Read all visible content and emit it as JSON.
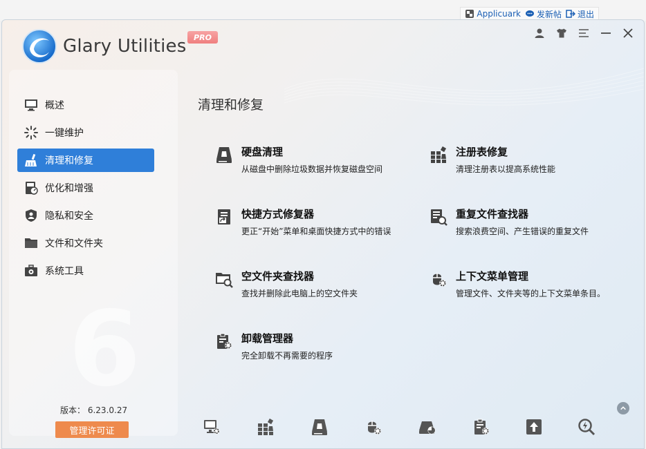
{
  "host": {
    "user": "Applicuark",
    "post_label": "发新帖",
    "logout_label": "退出"
  },
  "app": {
    "name": "Glary Utilities",
    "badge": "PRO",
    "accent_color": "#2f7fd9",
    "license_color": "#ee8a4d"
  },
  "window_controls": [
    "user-icon",
    "shirt-icon",
    "menu-icon",
    "minimize-icon",
    "close-icon"
  ],
  "sidebar": {
    "items": [
      {
        "label": "概述",
        "icon": "monitor-icon",
        "active": false
      },
      {
        "label": "一键维护",
        "icon": "sparkle-icon",
        "active": false
      },
      {
        "label": "清理和修复",
        "icon": "broom-icon",
        "active": true
      },
      {
        "label": "优化和增强",
        "icon": "speedometer-icon",
        "active": false
      },
      {
        "label": "隐私和安全",
        "icon": "shield-icon",
        "active": false
      },
      {
        "label": "文件和文件夹",
        "icon": "folder-icon",
        "active": false
      },
      {
        "label": "系统工具",
        "icon": "toolbox-icon",
        "active": false
      }
    ],
    "watermark": "6",
    "version_label": "版本：",
    "version": "6.23.0.27",
    "license_button": "管理许可证"
  },
  "main": {
    "title": "清理和修复",
    "tools": [
      {
        "title": "硬盘清理",
        "desc": "从磁盘中删除垃圾数据并恢复磁盘空间",
        "icon": "disk-cleaner-icon"
      },
      {
        "title": "注册表修复",
        "desc": "清理注册表以提高系统性能",
        "icon": "registry-icon"
      },
      {
        "title": "快捷方式修复器",
        "desc": "更正“开始”菜单和桌面快捷方式中的错误",
        "icon": "shortcut-icon"
      },
      {
        "title": "重复文件查找器",
        "desc": "搜索浪费空间、产生错误的重复文件",
        "icon": "duplicate-file-icon"
      },
      {
        "title": "空文件夹查找器",
        "desc": "查找并删除此电脑上的空文件夹",
        "icon": "empty-folder-icon"
      },
      {
        "title": "上下文菜单管理",
        "desc": "管理文件、文件夹等的上下文菜单条目。",
        "icon": "mouse-icon"
      },
      {
        "title": "卸载管理器",
        "desc": "完全卸载不再需要的程序",
        "icon": "uninstall-icon"
      }
    ]
  },
  "bottom_toolbar": [
    "monitor-gear-icon",
    "registry-icon",
    "disk-cleaner-icon",
    "mouse-icon",
    "disk-chart-icon",
    "uninstall-icon",
    "upload-icon",
    "search-bolt-icon"
  ],
  "scroll_up_icon": "chevron-up-icon"
}
